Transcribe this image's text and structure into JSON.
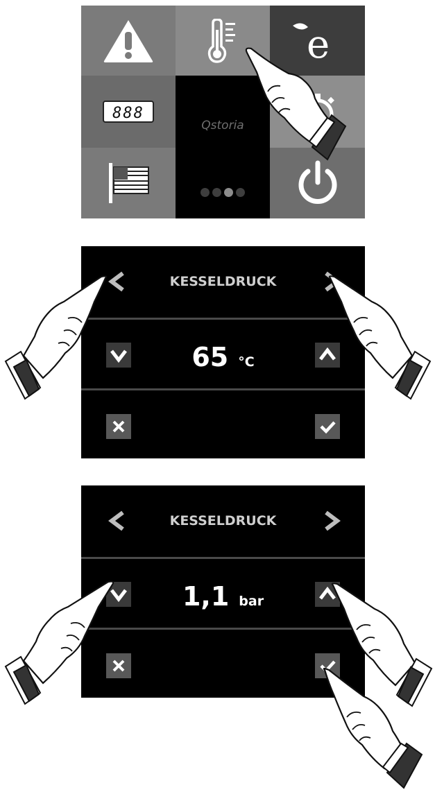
{
  "home": {
    "logo_text": "Qstoria",
    "page_indicator": {
      "pages": 4,
      "active": 3
    },
    "tiles": [
      {
        "name": "alarm",
        "icon": "warning-icon"
      },
      {
        "name": "temperature",
        "icon": "thermometer-icon"
      },
      {
        "name": "eco",
        "icon": "eco-leaf-icon"
      },
      {
        "name": "display",
        "icon": "digital-display-icon"
      },
      {
        "name": "timer",
        "icon": "stopwatch-icon"
      },
      {
        "name": "language",
        "icon": "flag-icon"
      },
      {
        "name": "power",
        "icon": "power-icon"
      }
    ]
  },
  "panels": [
    {
      "title": "KESSELDRUCK",
      "value": "65",
      "unit": "°C"
    },
    {
      "title": "KESSELDRUCK",
      "value": "1,1",
      "unit": "bar"
    }
  ],
  "colors": {
    "panel_bg": "#000000",
    "tile_dark": "#3d3d3d",
    "button_bg": "#3a3a3a",
    "text": "#ffffff"
  }
}
